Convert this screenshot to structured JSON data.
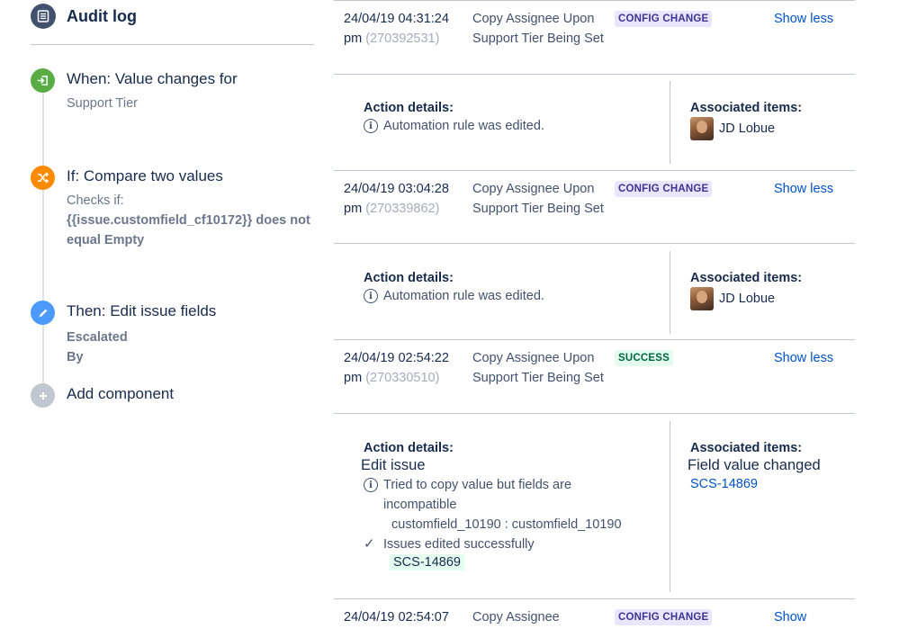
{
  "sidebar": {
    "title": "Audit log",
    "components": [
      {
        "title": "When: Value changes for",
        "lines": [
          "Support Tier"
        ],
        "icon": "trigger-icon",
        "color": "#5aac44"
      },
      {
        "title": "If: Compare two values",
        "lines": [
          "Checks if:"
        ],
        "bold": "{{issue.customfield_cf10172}} does not equal Empty",
        "icon": "shuffle-icon",
        "color": "#ff8b00"
      },
      {
        "title": "Then: Edit issue fields",
        "bold": "Escalated By",
        "icon": "pencil-icon",
        "color": "#4c9aff"
      },
      {
        "title": "Add component",
        "icon": "plus-icon",
        "color": "#c1c7d0"
      }
    ]
  },
  "entries": [
    {
      "date": "24/04/19 04:31:24",
      "ampm": "pm",
      "id": "(270392531)",
      "rule": "Copy Assignee Upon Support Tier Being Set",
      "status": "CONFIG CHANGE",
      "toggle": "Show less",
      "details_label": "Action details:",
      "details_text": "Automation rule was edited.",
      "assoc_label": "Associated items:",
      "assoc_user": "JD Lobue"
    },
    {
      "date": "24/04/19 03:04:28",
      "ampm": "pm",
      "id": "(270339862)",
      "rule": "Copy Assignee Upon Support Tier Being Set",
      "status": "CONFIG CHANGE",
      "toggle": "Show less",
      "details_label": "Action details:",
      "details_text": "Automation rule was edited.",
      "assoc_label": "Associated items:",
      "assoc_user": "JD Lobue"
    },
    {
      "date": "24/04/19 02:54:22",
      "ampm": "pm",
      "id": "(270330510)",
      "rule": "Copy Assignee Upon Support Tier Being Set",
      "status": "SUCCESS",
      "toggle": "Show less",
      "details_label": "Action details:",
      "action_name": "Edit issue",
      "warn_text": "Tried to copy value but fields are incompatible",
      "field_text": "customfield_10190 : customfield_10190",
      "ok_text": "Issues edited successfully",
      "ok_issue": "SCS-14869",
      "assoc_label": "Associated items:",
      "assoc_title": "Field value changed",
      "assoc_link": "SCS-14869"
    },
    {
      "date": "24/04/19 02:54:07",
      "rule": "Copy Assignee",
      "status": "CONFIG CHANGE",
      "toggle": "Show"
    }
  ],
  "colors": {
    "config_bg": "#eae6ff",
    "config_fg": "#403294",
    "success_bg": "#e3fcef",
    "success_fg": "#006644",
    "link": "#0052cc"
  }
}
